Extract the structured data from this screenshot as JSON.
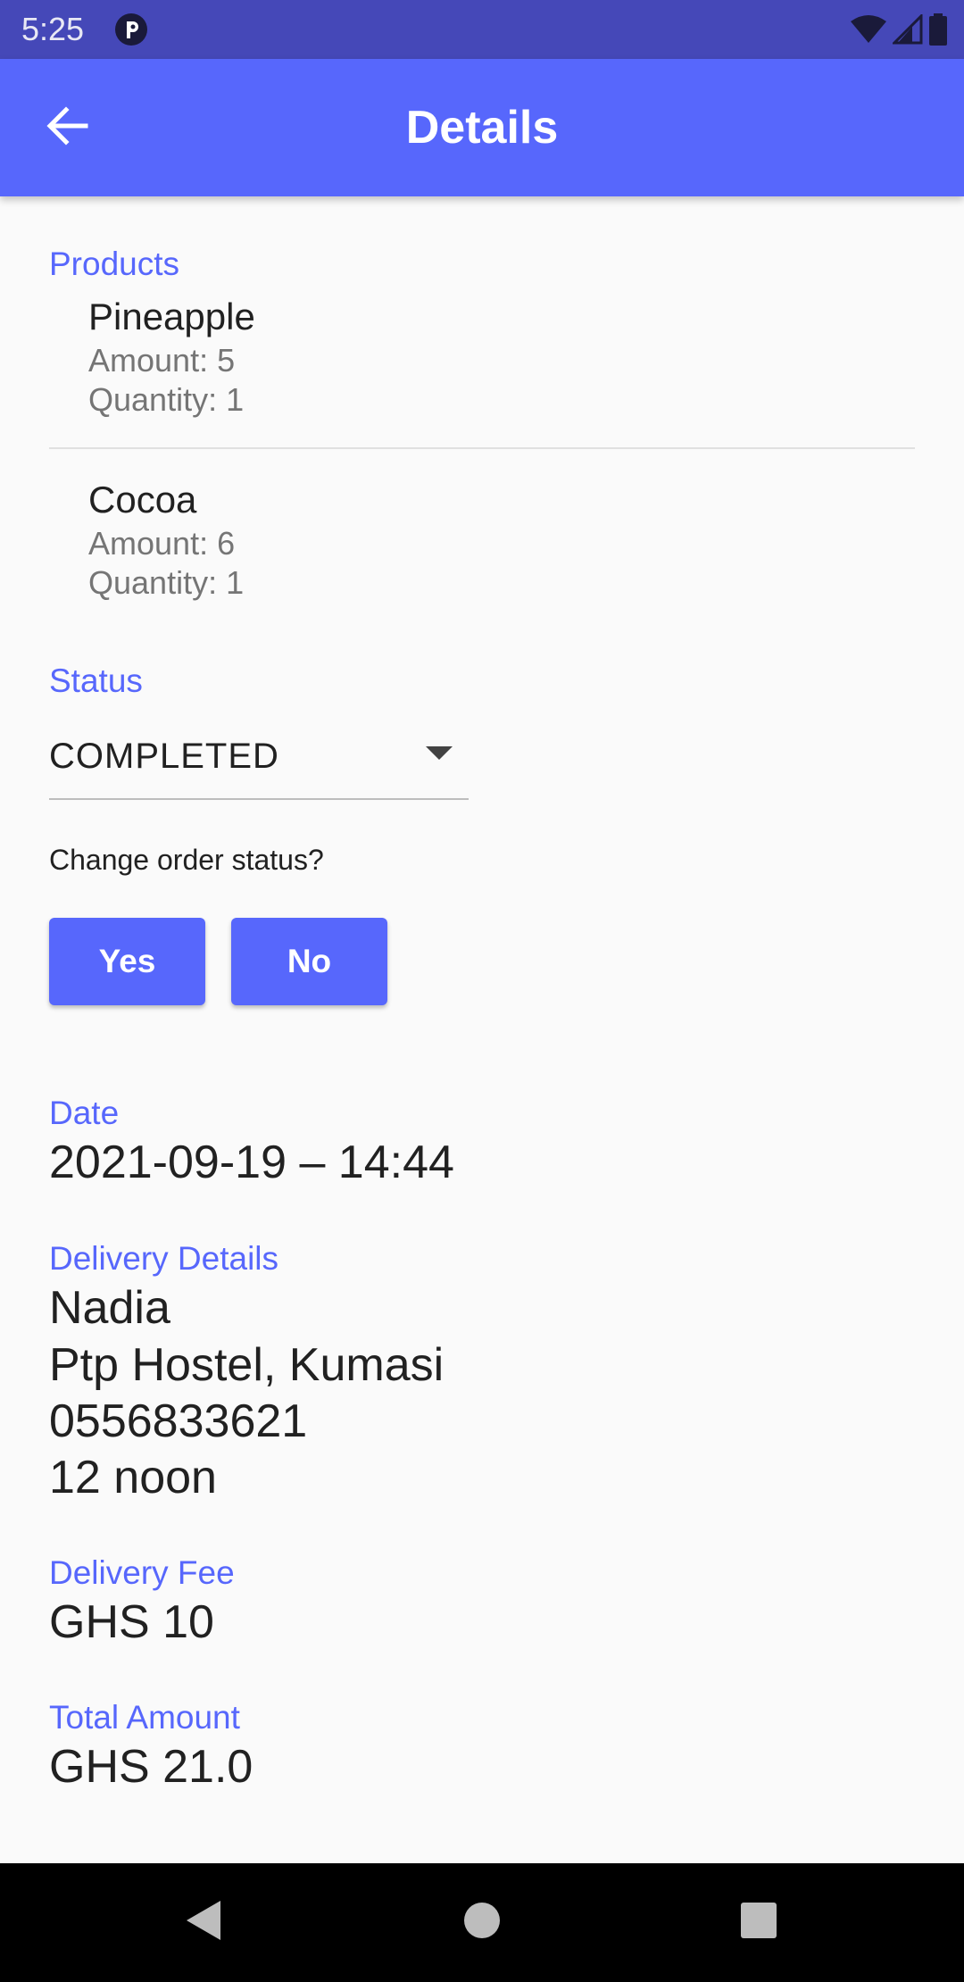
{
  "status_bar": {
    "time": "5:25",
    "icons": [
      "notification-p-icon",
      "wifi-icon",
      "signal-icon",
      "battery-icon"
    ]
  },
  "app_bar": {
    "title": "Details",
    "back_icon": "arrow-back-icon"
  },
  "products": {
    "label": "Products",
    "items": [
      {
        "name": "Pineapple",
        "amount": "Amount: 5",
        "quantity": "Quantity: 1"
      },
      {
        "name": "Cocoa",
        "amount": "Amount: 6",
        "quantity": "Quantity: 1"
      }
    ]
  },
  "status": {
    "label": "Status",
    "selected": "COMPLETED",
    "question": "Change order status?",
    "yes_label": "Yes",
    "no_label": "No"
  },
  "date": {
    "label": "Date",
    "value": "2021-09-19 – 14:44"
  },
  "delivery": {
    "label": "Delivery Details",
    "lines": [
      "Nadia",
      "Ptp Hostel, Kumasi",
      "0556833621",
      "12 noon"
    ]
  },
  "delivery_fee": {
    "label": "Delivery Fee",
    "value": "GHS 10"
  },
  "total": {
    "label": "Total Amount",
    "value": "GHS 21.0"
  },
  "colors": {
    "accent": "#5767fc",
    "status_bar": "#4548b8",
    "background": "#fafafa",
    "nav_bar": "#000000"
  }
}
